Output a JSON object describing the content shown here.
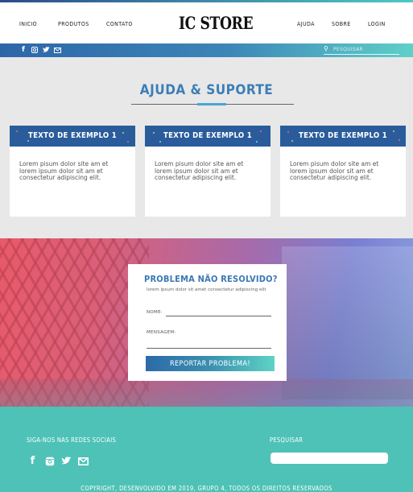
{
  "colors": {
    "primary_blue": "#2a5c9c",
    "title_blue": "#3c7eb8",
    "teal": "#4ec2b7",
    "page_bg": "#e8e8e8"
  },
  "nav": {
    "left": [
      "INICIO",
      "PRODUTOS",
      "CONTATO"
    ],
    "logo": "IC STORE",
    "right": [
      "AJUDA",
      "SOBRE",
      "LOGIN"
    ]
  },
  "socialbar": {
    "icons": [
      "facebook-icon",
      "instagram-icon",
      "twitter-icon",
      "mail-icon"
    ],
    "search_placeholder": "PESQUISAR"
  },
  "help": {
    "title": "AJUDA & SUPORTE",
    "cards": [
      {
        "title": "TEXTO DE EXEMPLO 1",
        "body": "Lorem pisum dolor site am et lorem ipsum dolor sit am et consectetur adipiscing elit."
      },
      {
        "title": "TEXTO DE EXEMPLO 1",
        "body": "Lorem pisum dolor site am et lorem ipsum dolor sit am et consectetur adipiscing elit."
      },
      {
        "title": "TEXTO DE EXEMPLO 1",
        "body": "Lorem pisum dolor site am et lorem ipsum dolor sit am et consectetur adipiscing elit."
      }
    ]
  },
  "form": {
    "title": "PROBLEMA NÃO RESOLVIDO?",
    "subtitle": "lorem ipsum dolor sit amet consectetur adipiscing elit",
    "name_label": "NOME:",
    "message_label": "MENSAGEM:",
    "button": "REPORTAR PROBLEMA!"
  },
  "footer": {
    "social_label": "SIGA-NOS NAS REDES SOCIAIS",
    "search_label": "PESQUISAR",
    "icons": [
      "facebook-icon",
      "instagram-icon",
      "twitter-icon",
      "mail-icon"
    ],
    "copyright": "COPYRIGHT, DESENVOLVIDO EM 2019, GRUPO 4, TODOS OS DIREITOS RESERVADOS"
  }
}
